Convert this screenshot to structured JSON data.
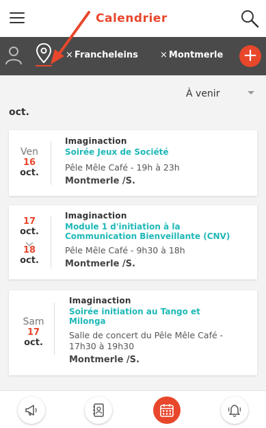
{
  "header": {
    "title": "Calendrier"
  },
  "filters": {
    "chips": [
      {
        "label": "Francheleins",
        "remove": "×"
      },
      {
        "label": "Montmerle",
        "remove": "×"
      }
    ],
    "add_label": "+"
  },
  "sort": {
    "selected": "À venir"
  },
  "month": "oct.",
  "events": [
    {
      "weekday": "Ven",
      "day": "16",
      "month": "oct.",
      "organizer": "Imaginaction",
      "title": "Soirée Jeux de Société",
      "place": "Pêle Mêle Café - 19h à 23h",
      "city": "Montmerle /S."
    },
    {
      "start_day": "17",
      "start_month": "oct.",
      "end_day": "18",
      "end_month": "oct.",
      "organizer": "Imaginaction",
      "title_line1": "Module 1 d'initiation à la",
      "title_line2": "Communication Bienveillante (CNV)",
      "place": "Pêle Mêle Café - 9h30 à 18h",
      "city": "Montmerle /S."
    },
    {
      "weekday": "Sam",
      "day": "17",
      "month": "oct.",
      "organizer": "Imaginaction",
      "title_line1": "Soirée initiation au Tango et",
      "title_line2": "Milonga",
      "place_line1": "Salle de concert du Pêle Mêle Café -",
      "place_line2": "17h30 à 19h30",
      "city": "Montmerle /S."
    }
  ],
  "colors": {
    "accent": "#e8472c",
    "teal": "#1fb8b8",
    "bar": "#4a4a4a"
  },
  "nav": [
    "megaphone-icon",
    "contacts-icon",
    "calendar-icon",
    "bell-icon"
  ]
}
